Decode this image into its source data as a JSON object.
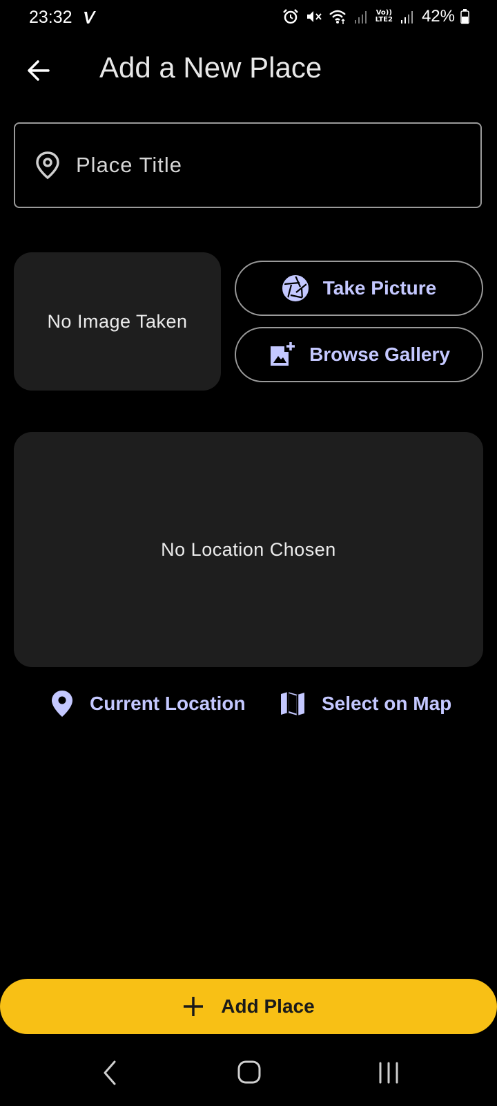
{
  "status_bar": {
    "time": "23:32",
    "battery": "42%",
    "network": "LTE2",
    "volte": "Vo))",
    "icons": [
      "alarm-icon",
      "mute-icon",
      "wifi-icon",
      "signal-icon",
      "signal-icon",
      "battery-icon"
    ]
  },
  "app_bar": {
    "title": "Add a New Place",
    "back_icon": "arrow-left-icon"
  },
  "form": {
    "title_placeholder": "Place Title",
    "title_value": "",
    "title_icon": "location-pin-outline-icon"
  },
  "image_section": {
    "empty_text": "No Image Taken",
    "take_picture_label": "Take Picture",
    "take_picture_icon": "camera-shutter-icon",
    "browse_gallery_label": "Browse Gallery",
    "browse_gallery_icon": "add-photo-icon"
  },
  "location_section": {
    "empty_text": "No Location Chosen",
    "current_location_label": "Current Location",
    "current_location_icon": "location-pin-icon",
    "select_on_map_label": "Select on Map",
    "select_on_map_icon": "map-icon"
  },
  "submit": {
    "label": "Add Place",
    "icon": "plus-icon"
  },
  "navigation_bar": {
    "items": [
      "back",
      "home",
      "recents"
    ]
  },
  "colors": {
    "background": "#000000",
    "surface": "#1e1e1e",
    "accent": "#c4c8ff",
    "primary_button": "#f8c015",
    "outline": "#9a9a9a"
  }
}
